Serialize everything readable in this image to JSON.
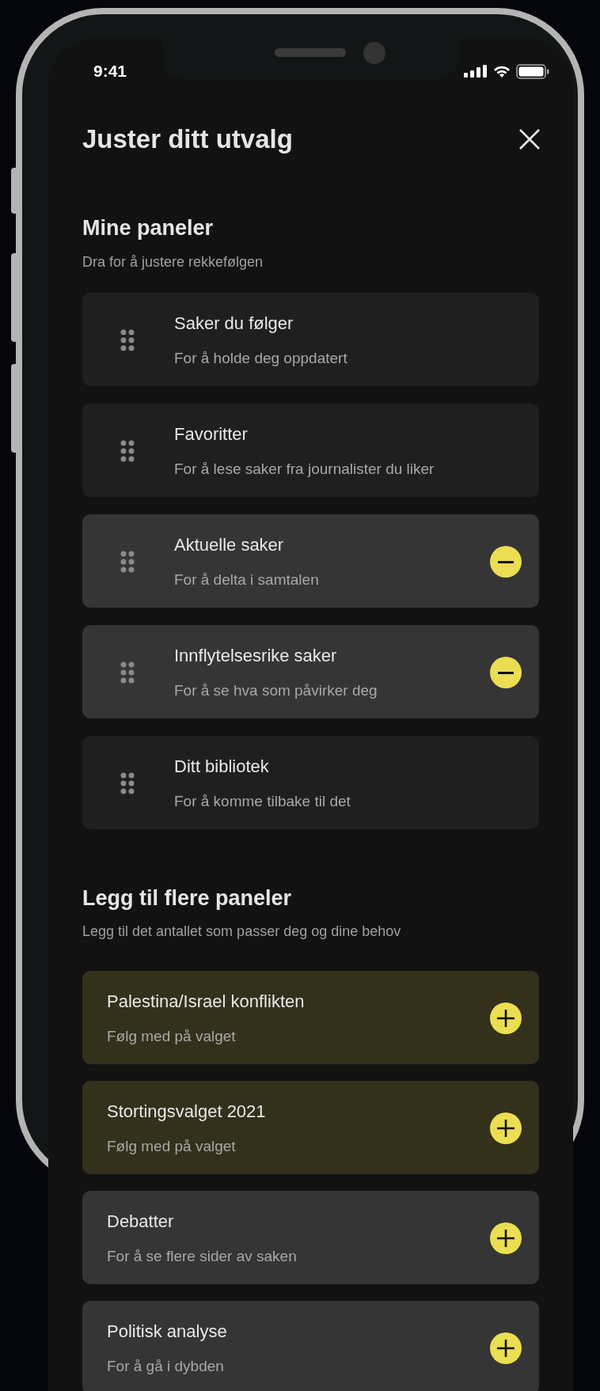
{
  "status_bar": {
    "time": "9:41"
  },
  "title": "Juster ditt utvalg",
  "my_panels": {
    "heading": "Mine paneler",
    "subtitle": "Dra for å justere rekkefølgen",
    "items": [
      {
        "title": "Saker du følger",
        "subtitle": "For å holde deg oppdatert",
        "removable": false
      },
      {
        "title": "Favoritter",
        "subtitle": "For å lese saker fra journalister du liker",
        "removable": false
      },
      {
        "title": "Aktuelle saker",
        "subtitle": "For å delta i samtalen",
        "removable": true
      },
      {
        "title": "Innflytelsesrike saker",
        "subtitle": "For å se hva som påvirker deg",
        "removable": true
      },
      {
        "title": "Ditt bibliotek",
        "subtitle": "For å komme tilbake til det",
        "removable": false
      }
    ]
  },
  "more_panels": {
    "heading": "Legg til flere paneler",
    "subtitle": "Legg til det antallet som passer deg og dine behov",
    "items": [
      {
        "title": "Palestina/Israel konflikten",
        "subtitle": "Følg med på valget",
        "highlighted": true
      },
      {
        "title": "Stortingsvalget 2021",
        "subtitle": "Følg med på valget",
        "highlighted": true
      },
      {
        "title": "Debatter",
        "subtitle": "For å se flere sider av saken",
        "highlighted": false
      },
      {
        "title": "Politisk analyse",
        "subtitle": "For å gå i dybden",
        "highlighted": false
      }
    ]
  }
}
